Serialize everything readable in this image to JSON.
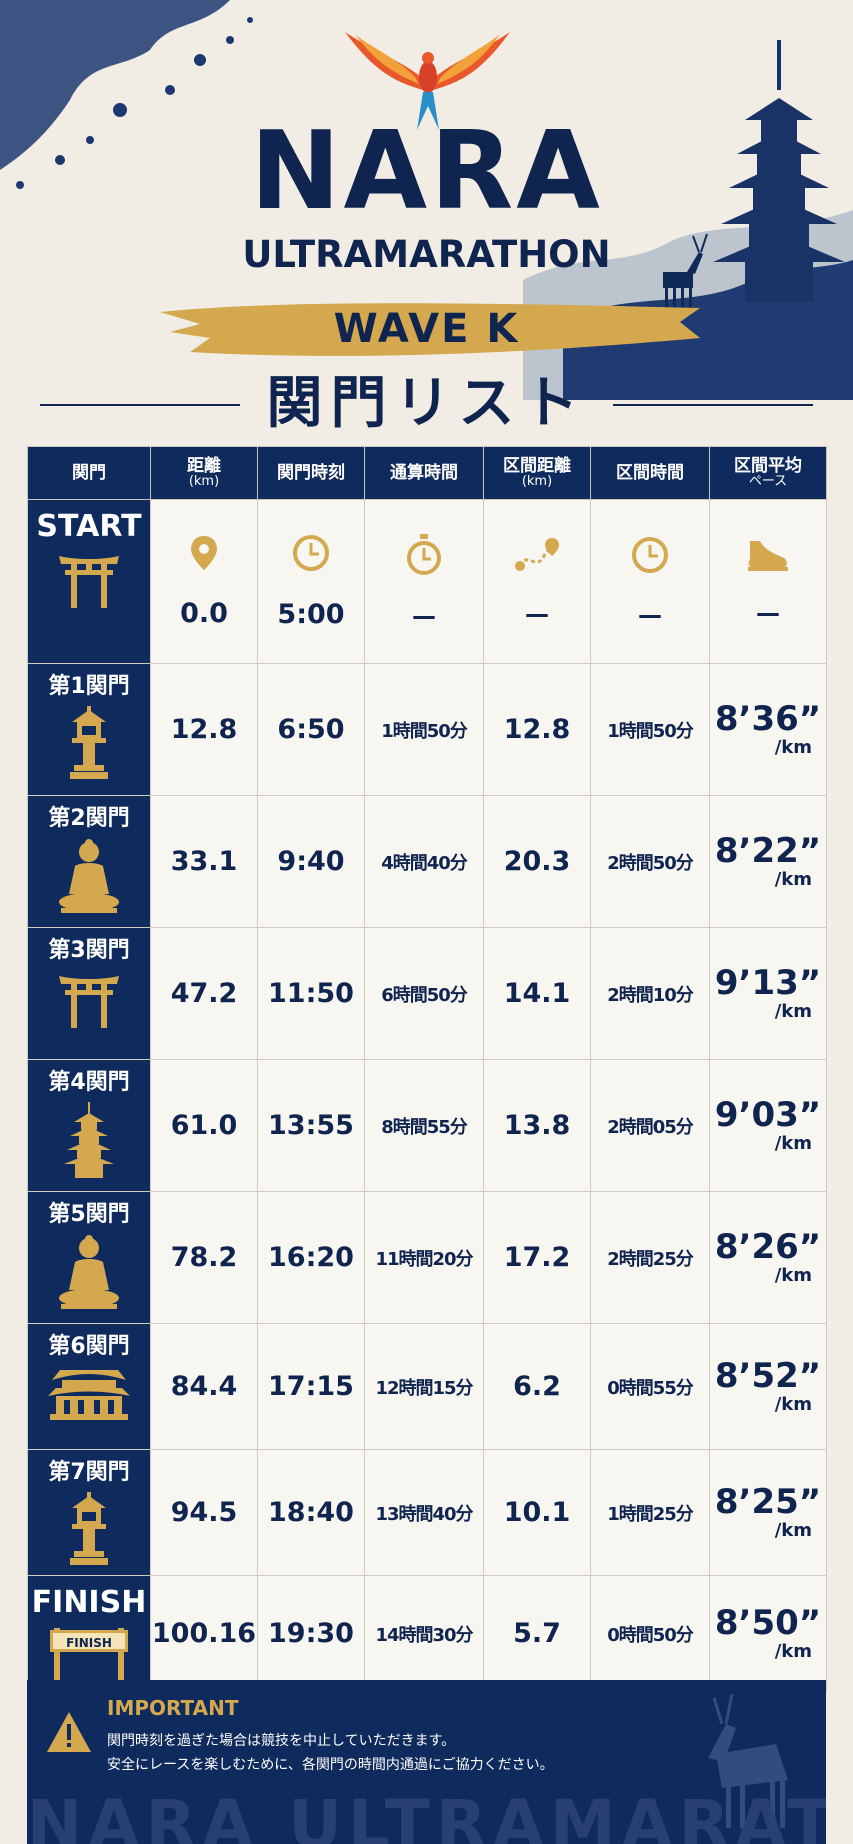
{
  "header": {
    "title_main": "NARA",
    "title_sub": "ULTRAMARATHON",
    "wave": "WAVE K",
    "list_heading": "関門リスト"
  },
  "colors": {
    "navy": "#0f2a5c",
    "gold": "#d3a84e",
    "paper": "#f1ede4"
  },
  "table": {
    "columns": [
      {
        "label": "関門",
        "unit": ""
      },
      {
        "label": "距離",
        "unit": "(km)"
      },
      {
        "label": "関門時刻",
        "unit": ""
      },
      {
        "label": "通算時間",
        "unit": ""
      },
      {
        "label": "区間距離",
        "unit": "(km)"
      },
      {
        "label": "区間時間",
        "unit": ""
      },
      {
        "label": "区間平均",
        "unit": "ペース"
      }
    ],
    "start": {
      "gate": "START",
      "gate_icon": "torii-icon",
      "distance": "0.0",
      "time": "5:00",
      "elapsed": "—",
      "section_distance": "—",
      "section_time": "—",
      "pace": "—",
      "icons": [
        "location-pin-icon",
        "clock-icon",
        "stopwatch-icon",
        "route-icon",
        "clock-icon",
        "shoe-icon"
      ]
    },
    "rows": [
      {
        "gate": "第1関門",
        "gate_icon": "stone-lantern-icon",
        "distance": "12.8",
        "time": "6:50",
        "elapsed": "1時間50分",
        "section_distance": "12.8",
        "section_time": "1時間50分",
        "pace": "8’36”",
        "pace_unit": "/km"
      },
      {
        "gate": "第2関門",
        "gate_icon": "buddha-icon",
        "distance": "33.1",
        "time": "9:40",
        "elapsed": "4時間40分",
        "section_distance": "20.3",
        "section_time": "2時間50分",
        "pace": "8’22”",
        "pace_unit": "/km"
      },
      {
        "gate": "第3関門",
        "gate_icon": "torii-icon",
        "distance": "47.2",
        "time": "11:50",
        "elapsed": "6時間50分",
        "section_distance": "14.1",
        "section_time": "2時間10分",
        "pace": "9’13”",
        "pace_unit": "/km"
      },
      {
        "gate": "第4関門",
        "gate_icon": "pagoda-icon",
        "distance": "61.0",
        "time": "13:55",
        "elapsed": "8時間55分",
        "section_distance": "13.8",
        "section_time": "2時間05分",
        "pace": "9’03”",
        "pace_unit": "/km"
      },
      {
        "gate": "第5関門",
        "gate_icon": "buddha-icon",
        "distance": "78.2",
        "time": "16:20",
        "elapsed": "11時間20分",
        "section_distance": "17.2",
        "section_time": "2時間25分",
        "pace": "8’26”",
        "pace_unit": "/km"
      },
      {
        "gate": "第6関門",
        "gate_icon": "temple-icon",
        "distance": "84.4",
        "time": "17:15",
        "elapsed": "12時間15分",
        "section_distance": "6.2",
        "section_time": "0時間55分",
        "pace": "8’52”",
        "pace_unit": "/km"
      },
      {
        "gate": "第7関門",
        "gate_icon": "stone-lantern-icon",
        "distance": "94.5",
        "time": "18:40",
        "elapsed": "13時間40分",
        "section_distance": "10.1",
        "section_time": "1時間25分",
        "pace": "8’25”",
        "pace_unit": "/km"
      },
      {
        "gate": "FINISH",
        "gate_sign": "FINISH",
        "gate_icon": "finish-gate-icon",
        "distance": "100.16",
        "time": "19:30",
        "elapsed": "14時間30分",
        "section_distance": "5.7",
        "section_time": "0時間50分",
        "pace": "8’50”",
        "pace_unit": "/km"
      }
    ]
  },
  "notice": {
    "title": "IMPORTANT",
    "line1": "関門時刻を過ぎた場合は競技を中止していただきます。",
    "line2": "安全にレースを楽しむために、各関門の時間内通過にご協力ください。",
    "watermark": "NARA ULTRAMARATHON"
  }
}
